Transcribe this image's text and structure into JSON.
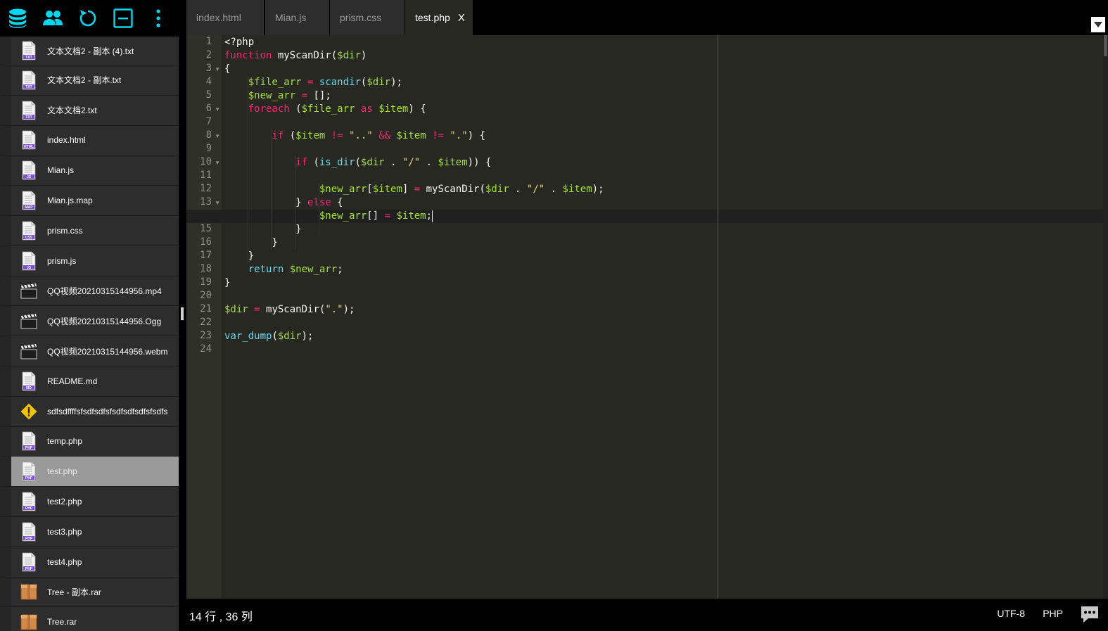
{
  "toolbar": {
    "buttons": [
      {
        "name": "database-icon"
      },
      {
        "name": "users-icon"
      },
      {
        "name": "refresh-icon"
      },
      {
        "name": "collapse-icon"
      },
      {
        "name": "more-vertical-icon"
      }
    ]
  },
  "files": [
    {
      "name": "文本文档2 - 副本 (4).txt",
      "icon": "TXT"
    },
    {
      "name": "文本文档2 - 副本.txt",
      "icon": "TXT"
    },
    {
      "name": "文本文档2.txt",
      "icon": "TXT"
    },
    {
      "name": "index.html",
      "icon": "HTML"
    },
    {
      "name": "Mian.js",
      "icon": "JS"
    },
    {
      "name": "Mian.js.map",
      "icon": "MAP"
    },
    {
      "name": "prism.css",
      "icon": "CSS"
    },
    {
      "name": "prism.js",
      "icon": "JS"
    },
    {
      "name": "QQ视频20210315144956.mp4",
      "icon": "video"
    },
    {
      "name": "QQ视频20210315144956.Ogg",
      "icon": "video"
    },
    {
      "name": "QQ视频20210315144956.webm",
      "icon": "video"
    },
    {
      "name": "README.md",
      "icon": "MD"
    },
    {
      "name": "sdfsdffffsfsdfsdfsfsdfsdfsdfsfsdfs",
      "icon": "warning"
    },
    {
      "name": "temp.php",
      "icon": "PHP"
    },
    {
      "name": "test.php",
      "icon": "PHP",
      "selected": true
    },
    {
      "name": "test2.php",
      "icon": "PHP"
    },
    {
      "name": "test3.php",
      "icon": "PHP"
    },
    {
      "name": "test4.php",
      "icon": "PHP"
    },
    {
      "name": "Tree - 副本.rar",
      "icon": "archive"
    },
    {
      "name": "Tree.rar",
      "icon": "archive"
    }
  ],
  "tabs": [
    {
      "label": "index.html",
      "active": false
    },
    {
      "label": "Mian.js",
      "active": false
    },
    {
      "label": "prism.css",
      "active": false
    },
    {
      "label": "test.php",
      "active": true,
      "close": "X"
    }
  ],
  "editor": {
    "active_line": 14,
    "fold_lines": [
      3,
      6,
      8,
      10,
      13
    ],
    "lines": [
      [
        [
          "p",
          "<?php"
        ]
      ],
      [
        [
          "k",
          "function"
        ],
        [
          "p",
          " myScanDir("
        ],
        [
          "v",
          "$dir"
        ],
        [
          "p",
          ")"
        ]
      ],
      [
        [
          "p",
          "{"
        ]
      ],
      [
        [
          "p",
          "    "
        ],
        [
          "v",
          "$file_arr"
        ],
        [
          "p",
          " "
        ],
        [
          "k",
          "="
        ],
        [
          "p",
          " "
        ],
        [
          "fn",
          "scandir"
        ],
        [
          "p",
          "("
        ],
        [
          "v",
          "$dir"
        ],
        [
          "p",
          ");"
        ]
      ],
      [
        [
          "p",
          "    "
        ],
        [
          "v",
          "$new_arr"
        ],
        [
          "p",
          " "
        ],
        [
          "k",
          "="
        ],
        [
          "p",
          " [];"
        ]
      ],
      [
        [
          "p",
          "    "
        ],
        [
          "k",
          "foreach"
        ],
        [
          "p",
          " ("
        ],
        [
          "v",
          "$file_arr"
        ],
        [
          "p",
          " "
        ],
        [
          "k",
          "as"
        ],
        [
          "p",
          " "
        ],
        [
          "v",
          "$item"
        ],
        [
          "p",
          ") {"
        ]
      ],
      [
        [
          "p",
          ""
        ]
      ],
      [
        [
          "p",
          "        "
        ],
        [
          "k",
          "if"
        ],
        [
          "p",
          " ("
        ],
        [
          "v",
          "$item"
        ],
        [
          "p",
          " "
        ],
        [
          "k",
          "!="
        ],
        [
          "p",
          " "
        ],
        [
          "s",
          "\"..\""
        ],
        [
          "p",
          " "
        ],
        [
          "k",
          "&&"
        ],
        [
          "p",
          " "
        ],
        [
          "v",
          "$item"
        ],
        [
          "p",
          " "
        ],
        [
          "k",
          "!="
        ],
        [
          "p",
          " "
        ],
        [
          "s",
          "\".\""
        ],
        [
          "p",
          ") {"
        ]
      ],
      [
        [
          "p",
          ""
        ]
      ],
      [
        [
          "p",
          "            "
        ],
        [
          "k",
          "if"
        ],
        [
          "p",
          " ("
        ],
        [
          "fn",
          "is_dir"
        ],
        [
          "p",
          "("
        ],
        [
          "v",
          "$dir"
        ],
        [
          "p",
          " . "
        ],
        [
          "s",
          "\"/\""
        ],
        [
          "p",
          " . "
        ],
        [
          "v",
          "$item"
        ],
        [
          "p",
          ")) {"
        ]
      ],
      [
        [
          "p",
          ""
        ]
      ],
      [
        [
          "p",
          "                "
        ],
        [
          "v",
          "$new_arr"
        ],
        [
          "p",
          "["
        ],
        [
          "v",
          "$item"
        ],
        [
          "p",
          "] "
        ],
        [
          "k",
          "="
        ],
        [
          "p",
          " myScanDir("
        ],
        [
          "v",
          "$dir"
        ],
        [
          "p",
          " . "
        ],
        [
          "s",
          "\"/\""
        ],
        [
          "p",
          " . "
        ],
        [
          "v",
          "$item"
        ],
        [
          "p",
          ");"
        ]
      ],
      [
        [
          "p",
          "            } "
        ],
        [
          "k",
          "else"
        ],
        [
          "p",
          " {"
        ]
      ],
      [
        [
          "p",
          "                "
        ],
        [
          "v",
          "$new_arr"
        ],
        [
          "p",
          "[] "
        ],
        [
          "k",
          "="
        ],
        [
          "p",
          " "
        ],
        [
          "v",
          "$item"
        ],
        [
          "p",
          ";"
        ]
      ],
      [
        [
          "p",
          "            }"
        ]
      ],
      [
        [
          "p",
          "        }"
        ]
      ],
      [
        [
          "p",
          "    }"
        ]
      ],
      [
        [
          "p",
          "    "
        ],
        [
          "fn",
          "return"
        ],
        [
          "p",
          " "
        ],
        [
          "v",
          "$new_arr"
        ],
        [
          "p",
          ";"
        ]
      ],
      [
        [
          "p",
          "}"
        ]
      ],
      [
        [
          "p",
          ""
        ]
      ],
      [
        [
          "v",
          "$dir"
        ],
        [
          "p",
          " "
        ],
        [
          "k",
          "="
        ],
        [
          "p",
          " myScanDir("
        ],
        [
          "s",
          "\".\""
        ],
        [
          "p",
          ");"
        ]
      ],
      [
        [
          "p",
          ""
        ]
      ],
      [
        [
          "fn",
          "var_dump"
        ],
        [
          "p",
          "("
        ],
        [
          "v",
          "$dir"
        ],
        [
          "p",
          ");"
        ]
      ],
      [
        [
          "p",
          ""
        ]
      ]
    ]
  },
  "status": {
    "cursor_position": "14 行 , 36 列",
    "encoding": "UTF-8",
    "language": "PHP"
  },
  "colors": {
    "accent": "#00d8f0",
    "php_badge": "#7b4fd6",
    "html_badge": "#7b4fd6",
    "js_badge": "#7b4fd6",
    "warning": "#f5c400",
    "archive": "#d08a4a"
  }
}
